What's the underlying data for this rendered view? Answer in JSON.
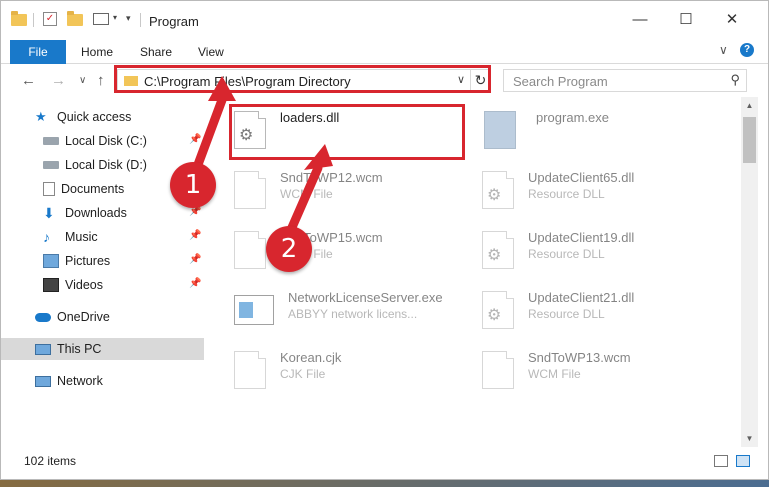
{
  "window": {
    "title": "Program",
    "minimize": "—",
    "maximize": "☐",
    "close": "✕"
  },
  "ribbon": {
    "tabs": [
      "File",
      "Home",
      "Share",
      "View"
    ],
    "expand": "∨",
    "help": "?"
  },
  "nav": {
    "back": "←",
    "forward": "→",
    "recent": "∨",
    "up": "↑",
    "address": "C:\\Program Files\\Program Directory",
    "address_dropdown": "∨",
    "refresh": "↻",
    "search_placeholder": "Search Program",
    "search_icon": "⚲"
  },
  "sidebar": {
    "items": [
      {
        "label": "Quick access",
        "icon": "star-icon"
      },
      {
        "label": "Local Disk (C:)",
        "icon": "drive-icon",
        "pinned": true
      },
      {
        "label": "Local Disk (D:)",
        "icon": "drive-icon",
        "pinned": false
      },
      {
        "label": "Documents",
        "icon": "documents-icon",
        "pinned": true
      },
      {
        "label": "Downloads",
        "icon": "download-icon",
        "pinned": true
      },
      {
        "label": "Music",
        "icon": "music-icon",
        "pinned": true
      },
      {
        "label": "Pictures",
        "icon": "pictures-icon",
        "pinned": true
      },
      {
        "label": "Videos",
        "icon": "videos-icon",
        "pinned": true
      },
      {
        "label": "OneDrive",
        "icon": "cloud-icon"
      },
      {
        "label": "This PC",
        "icon": "computer-icon",
        "selected": true
      },
      {
        "label": "Network",
        "icon": "network-icon"
      }
    ]
  },
  "files": [
    {
      "name": "loaders.dll",
      "type": "",
      "icon": "dll-gear-icon"
    },
    {
      "name": "program.exe",
      "type": "",
      "icon": "exe-icon"
    },
    {
      "name": "SndToWP12.wcm",
      "type": "WCM File",
      "icon": "file-icon"
    },
    {
      "name": "UpdateClient65.dll",
      "type": "Resource DLL",
      "icon": "dll-gear-icon"
    },
    {
      "name": "SndToWP15.wcm",
      "type": "WCM File",
      "icon": "file-icon"
    },
    {
      "name": "UpdateClient19.dll",
      "type": "Resource DLL",
      "icon": "dll-gear-icon"
    },
    {
      "name": "NetworkLicenseServer.exe",
      "type": "ABBYY network licens...",
      "icon": "exe-window-icon"
    },
    {
      "name": "UpdateClient21.dll",
      "type": "Resource DLL",
      "icon": "dll-gear-icon"
    },
    {
      "name": "Korean.cjk",
      "type": "CJK File",
      "icon": "file-icon"
    },
    {
      "name": "SndToWP13.wcm",
      "type": "WCM File",
      "icon": "file-icon"
    }
  ],
  "status": {
    "item_count": "102 items"
  },
  "callouts": {
    "one": "1",
    "two": "2"
  },
  "colors": {
    "accent": "#1979ca",
    "highlight_red": "#d8262e",
    "selected_bg": "#d9d9d9"
  }
}
